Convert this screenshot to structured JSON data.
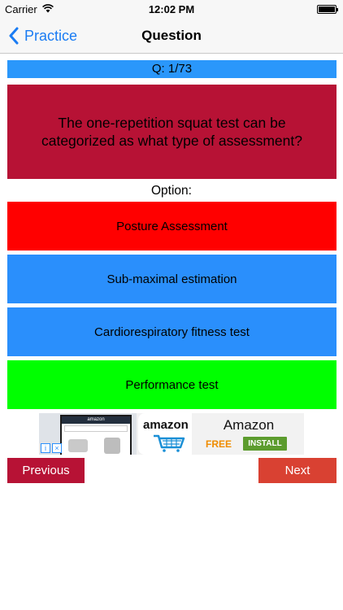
{
  "status_bar": {
    "carrier": "Carrier",
    "time": "12:02 PM",
    "wifi_icon": "wifi-icon",
    "battery_icon": "battery-icon"
  },
  "nav": {
    "back_label": "Practice",
    "title": "Question",
    "back_icon": "chevron-left-icon"
  },
  "quiz": {
    "counter": "Q: 1/73",
    "question": "The one-repetition squat test can be categorized as what type of assessment?",
    "option_heading": "Option:",
    "options": [
      {
        "label": "Posture Assessment",
        "color": "#ff0000"
      },
      {
        "label": "Sub-maximal estimation",
        "color": "#2a8ffc"
      },
      {
        "label": "Cardiorespiratory fitness test",
        "color": "#2a8ffc"
      },
      {
        "label": "Performance test",
        "color": "#00ff00"
      }
    ]
  },
  "ad": {
    "icon_text": "amazon",
    "app_name": "Amazon",
    "price": "FREE",
    "install_label": "INSTALL",
    "phone_header": "amazon"
  },
  "footer": {
    "previous_label": "Previous",
    "next_label": "Next"
  },
  "colors": {
    "counter_bg": "#2a97fb",
    "question_bg": "#b71235",
    "previous_bg": "#b71235",
    "next_bg": "#d94132",
    "link": "#1a7cf3"
  }
}
